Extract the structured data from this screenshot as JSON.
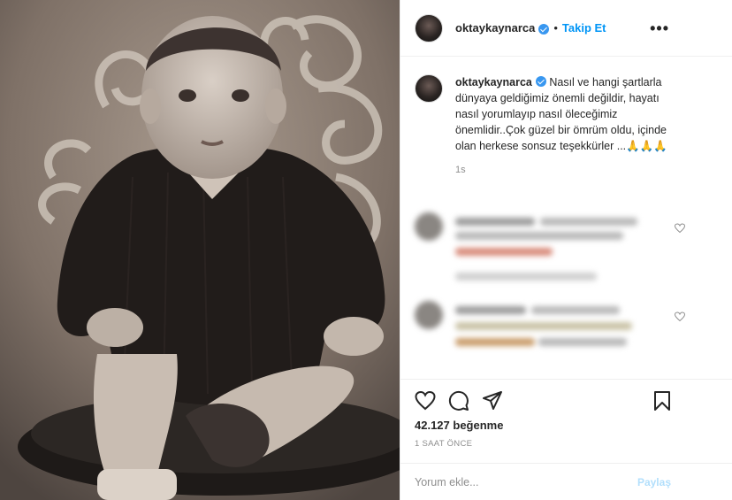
{
  "post": {
    "author": "oktaykaynarca",
    "follow_label": "Takip Et",
    "dot": "•",
    "more_label": "•••",
    "caption_author": "oktaykaynarca",
    "caption_text": "Nasıl ve hangi şartlarla dünyaya geldiğimiz önemli değildir, hayatı nasıl yorumlayıp nasıl öleceğimiz önemlidir..Çok güzel bir ömrüm oldu, içinde olan herkese sonsuz teşekkürler ...🙏🙏🙏",
    "caption_time": "1s",
    "likes": "42.127 beğenme",
    "time_ago": "1 SAAT ÖNCE",
    "comment_placeholder": "Yorum ekle...",
    "post_label": "Paylaş"
  },
  "icons": {
    "like": "heart-icon",
    "comment": "comment-icon",
    "share": "share-icon",
    "save": "bookmark-icon"
  },
  "colors": {
    "accent": "#0095f6",
    "verified": "#3897f0",
    "muted": "#8e8e8e"
  }
}
